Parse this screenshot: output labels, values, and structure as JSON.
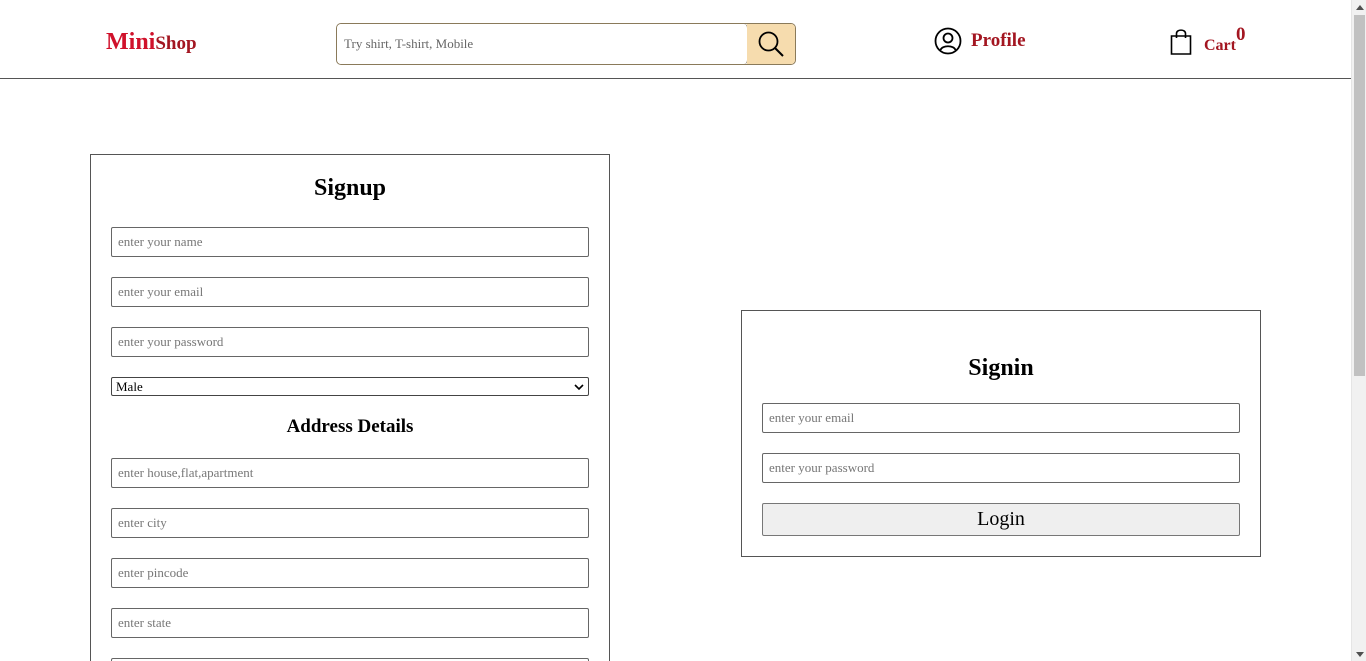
{
  "header": {
    "logo_part1": "Mini",
    "logo_part2": "Shop",
    "search_placeholder": "Try shirt, T-shirt, Mobile",
    "search_icon": "search-icon",
    "profile_label": "Profile",
    "profile_icon": "user-circle-icon",
    "cart_label": "Cart",
    "cart_count": "0",
    "cart_icon": "shopping-bag-icon",
    "brand_color": "#a31621",
    "search_button_color": "#f6dcae"
  },
  "signup": {
    "title": "Signup",
    "name_placeholder": "enter your name",
    "email_placeholder": "enter your email",
    "password_placeholder": "enter your password",
    "gender_selected": "Male",
    "address_title": "Address Details",
    "house_placeholder": "enter house,flat,apartment",
    "city_placeholder": "enter city",
    "pincode_placeholder": "enter pincode",
    "state_placeholder": "enter state"
  },
  "signin": {
    "title": "Signin",
    "email_placeholder": "enter your email",
    "password_placeholder": "enter your password",
    "login_label": "Login"
  }
}
